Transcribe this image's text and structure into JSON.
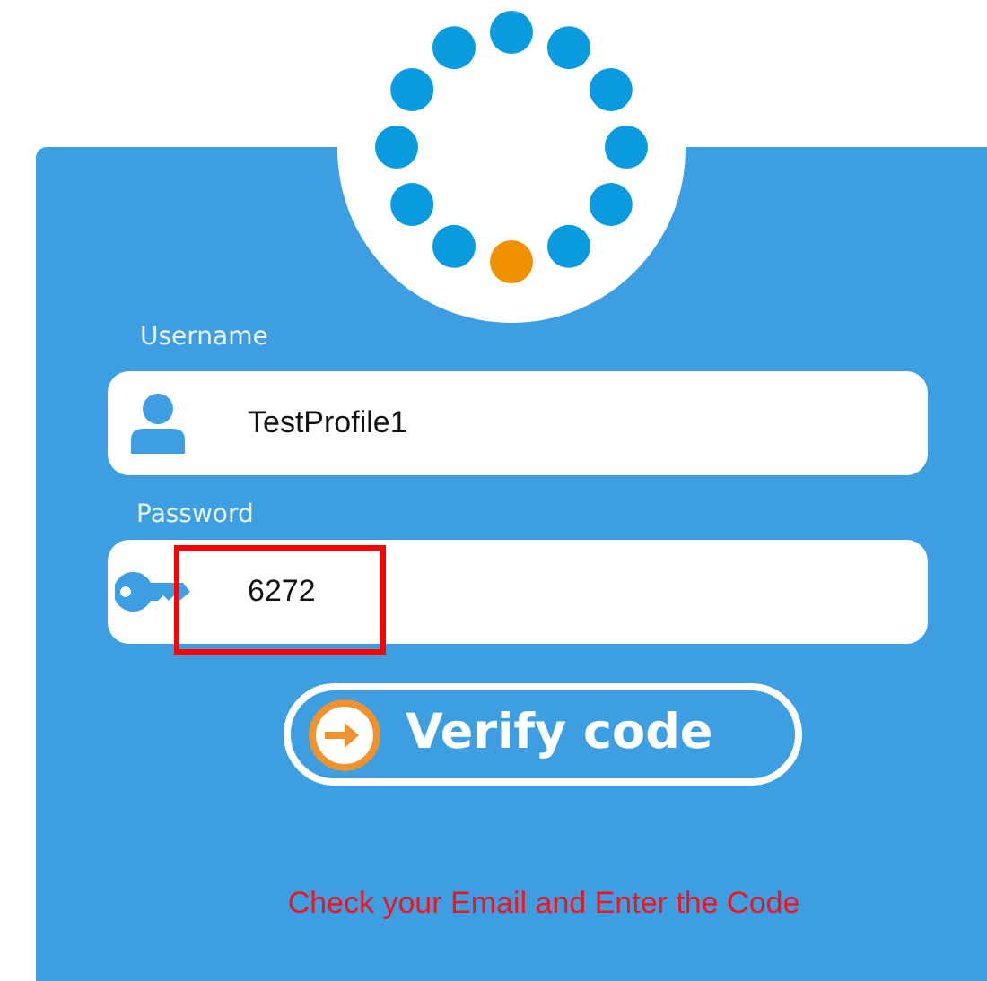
{
  "username": {
    "label": "Username",
    "value": "TestProfile1"
  },
  "password": {
    "label": "Password",
    "value": "6272"
  },
  "button": {
    "label": "Verify code"
  },
  "message": "Check your Email and Enter the Code"
}
